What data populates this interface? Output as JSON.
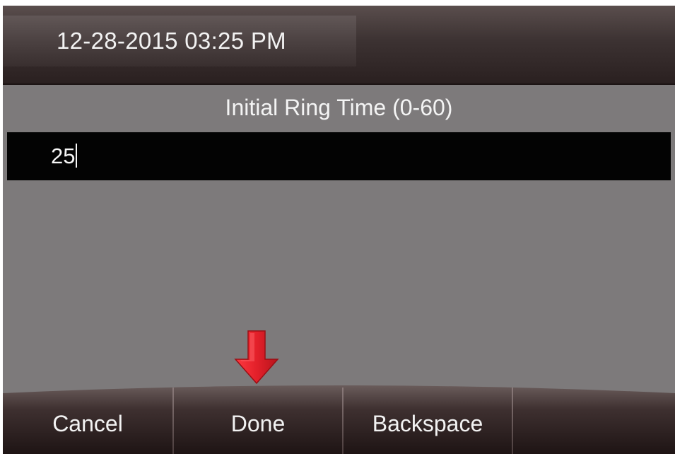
{
  "status_bar": {
    "datetime": "12-28-2015 03:25 PM"
  },
  "field": {
    "title": "Initial Ring Time (0-60)",
    "value": "25"
  },
  "indicator": {
    "icon": "down-arrow-icon",
    "color": "#e0202a",
    "points_to": "Done"
  },
  "softkeys": [
    {
      "label": "Cancel"
    },
    {
      "label": "Done"
    },
    {
      "label": "Backspace"
    },
    {
      "label": ""
    }
  ],
  "colors": {
    "screen_background": "#7d7a7b",
    "input_background": "#030303",
    "bar_dark": "#2a2020",
    "text": "#f2f2f2"
  }
}
